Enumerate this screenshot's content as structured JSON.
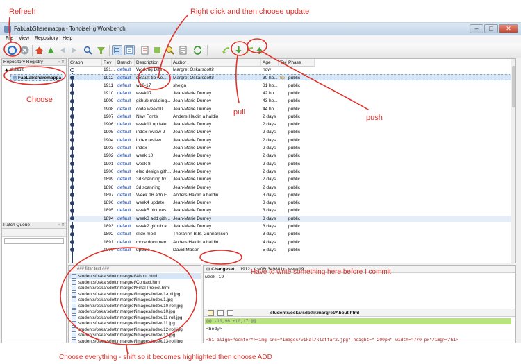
{
  "window": {
    "title": "FabLabSharemappa - TortoiseHg Workbench"
  },
  "menu": [
    "File",
    "View",
    "Repository",
    "Help"
  ],
  "toolbar_icons": [
    "refresh-icon",
    "stop-icon",
    "home-icon",
    "goto-icon",
    "back-icon",
    "forward-icon",
    "search-icon",
    "filter-icon",
    "log-view-icon",
    "manifest-view-icon",
    "annotate-icon",
    "grep-icon",
    "zoom-icon",
    "status-icon",
    "sync-icon",
    "incoming-icon",
    "pull-icon",
    "outgoing-icon",
    "push-icon"
  ],
  "left_panel": {
    "registry_title": "Repository Registry",
    "group": "default",
    "repo": "FabLabSharemappa",
    "patch_queue_title": "Patch Queue"
  },
  "columns": [
    "Graph",
    "Rev",
    "Branch",
    "Description",
    "Author",
    "Age",
    "Tags",
    "Phase"
  ],
  "rows": [
    {
      "rev": "191...",
      "branch": "default",
      "desc": "Working Dire...",
      "author": "Margret Oskarsdottir",
      "age": "now",
      "tags": "",
      "phase": "",
      "kind": "wd"
    },
    {
      "rev": "1912",
      "branch": "default",
      "desc": "default tip  we...",
      "author": "Margret Oskarsdottir",
      "age": "30 ho...",
      "tags": "tip",
      "phase": "public",
      "kind": "sel"
    },
    {
      "rev": "1911",
      "branch": "default",
      "desc": "w10-17",
      "author": "shelga",
      "age": "31 ho...",
      "tags": "",
      "phase": "public",
      "kind": ""
    },
    {
      "rev": "1910",
      "branch": "default",
      "desc": "week17",
      "author": "Jean-Marie Durney",
      "age": "42 ho...",
      "tags": "",
      "phase": "public",
      "kind": ""
    },
    {
      "rev": "1909",
      "branch": "default",
      "desc": "github mol.ding...",
      "author": "Jean-Marie Durney",
      "age": "43 ho...",
      "tags": "",
      "phase": "public",
      "kind": ""
    },
    {
      "rev": "1908",
      "branch": "default",
      "desc": "code week10",
      "author": "Jean-Marie Durney",
      "age": "44 ho...",
      "tags": "",
      "phase": "public",
      "kind": ""
    },
    {
      "rev": "1907",
      "branch": "default",
      "desc": "New Fonts",
      "author": "Anders Haldin  a haldin",
      "age": "2 days",
      "tags": "",
      "phase": "public",
      "kind": ""
    },
    {
      "rev": "1906",
      "branch": "default",
      "desc": "week11 update",
      "author": "Jean-Marie Durney",
      "age": "2 days",
      "tags": "",
      "phase": "public",
      "kind": ""
    },
    {
      "rev": "1905",
      "branch": "default",
      "desc": "index review 2",
      "author": "Jean-Marie Durney",
      "age": "2 days",
      "tags": "",
      "phase": "public",
      "kind": ""
    },
    {
      "rev": "1904",
      "branch": "default",
      "desc": "index review",
      "author": "Jean-Marie Durney",
      "age": "2 days",
      "tags": "",
      "phase": "public",
      "kind": ""
    },
    {
      "rev": "1903",
      "branch": "default",
      "desc": "index",
      "author": "Jean-Marie Durney",
      "age": "2 days",
      "tags": "",
      "phase": "public",
      "kind": ""
    },
    {
      "rev": "1902",
      "branch": "default",
      "desc": "week 10",
      "author": "Jean-Marie Durney",
      "age": "2 days",
      "tags": "",
      "phase": "public",
      "kind": ""
    },
    {
      "rev": "1901",
      "branch": "default",
      "desc": "week 8",
      "author": "Jean-Marie Durney",
      "age": "2 days",
      "tags": "",
      "phase": "public",
      "kind": ""
    },
    {
      "rev": "1900",
      "branch": "default",
      "desc": "elec design gith...",
      "author": "Jean-Marie Durney",
      "age": "2 days",
      "tags": "",
      "phase": "public",
      "kind": ""
    },
    {
      "rev": "1899",
      "branch": "default",
      "desc": "3d scanning fix ...",
      "author": "Jean-Marie Durney",
      "age": "2 days",
      "tags": "",
      "phase": "public",
      "kind": ""
    },
    {
      "rev": "1898",
      "branch": "default",
      "desc": "3d scanning",
      "author": "Jean-Marie Durney",
      "age": "2 days",
      "tags": "",
      "phase": "public",
      "kind": ""
    },
    {
      "rev": "1897",
      "branch": "default",
      "desc": "Week 16 adn Fi...",
      "author": "Anders Haldin  a haldin",
      "age": "3 days",
      "tags": "",
      "phase": "public",
      "kind": ""
    },
    {
      "rev": "1896",
      "branch": "default",
      "desc": "week4 update",
      "author": "Jean-Marie Durney",
      "age": "3 days",
      "tags": "",
      "phase": "public",
      "kind": ""
    },
    {
      "rev": "1895",
      "branch": "default",
      "desc": "week5 pictures ...",
      "author": "Jean-Marie Durney",
      "age": "3 days",
      "tags": "",
      "phase": "public",
      "kind": ""
    },
    {
      "rev": "1894",
      "branch": "default",
      "desc": "week3 add gith...",
      "author": "Jean-Marie Durney",
      "age": "3 days",
      "tags": "",
      "phase": "public",
      "kind": "hl"
    },
    {
      "rev": "1893",
      "branch": "default",
      "desc": "week2 github a...",
      "author": "Jean-Marie Durney",
      "age": "3 days",
      "tags": "",
      "phase": "public",
      "kind": ""
    },
    {
      "rev": "1892",
      "branch": "default",
      "desc": "slide mod",
      "author": "Thorarinn B.B. Gunnarsson",
      "age": "3 days",
      "tags": "",
      "phase": "public",
      "kind": ""
    },
    {
      "rev": "1891",
      "branch": "default",
      "desc": "more documen...",
      "author": "Anders Haldin  a haldin",
      "age": "4 days",
      "tags": "",
      "phase": "public",
      "kind": ""
    },
    {
      "rev": "1890",
      "branch": "default",
      "desc": "update",
      "author": "David Mason",
      "age": "5 days",
      "tags": "",
      "phase": "public",
      "kind": ""
    }
  ],
  "files": {
    "filter_placeholder": "### filter text ###",
    "items": [
      "students/oskarsdottir.margret/About.html",
      "students/oskarsdottir.margret/Contact.html",
      "students/oskarsdottir.margret/Final Project.html",
      "students/oskarsdottir.margret/images/Index/1-roll.jpg",
      "students/oskarsdottir.margret/images/Index/1.jpg",
      "students/oskarsdottir.margret/images/Index/10-roll.jpg",
      "students/oskarsdottir.margret/images/Index/10.jpg",
      "students/oskarsdottir.margret/images/Index/11-roll.jpg",
      "students/oskarsdottir.margret/images/Index/11.jpg",
      "students/oskarsdottir.margret/images/Index/12-roll.jpg",
      "students/oskarsdottir.margret/images/Index/12.jpg",
      "students/oskarsdottir.margret/images/Index/13-roll.jpg"
    ]
  },
  "changeset": {
    "label": "Changeset:",
    "rev": "1912",
    "hash": "(ce08c349881)",
    "name": "week19",
    "message": "week 19",
    "diff_file": "students/oskarsdottir.margret/About.html",
    "hunk": "@@ -10,96 +10,17 @@",
    "lines": [
      "<body>",
      "<h1 align=\"center\"><img src=\"images/vikal/klettar2.jpg\" height=\" 200px\" width=\"770 px\"/img></h1>"
    ]
  },
  "annotations": {
    "refresh": "Refresh",
    "right_click": "Right click and then choose update",
    "choose": "Choose",
    "pull": "pull",
    "push": "push",
    "write": "Have to write something here before I commit",
    "choose_everything": "Choose everything - shift so it becomes highlighted then choose ADD"
  },
  "colors": {
    "annotation": "#e0312a",
    "selection": "#d7e6f6",
    "diff_hunk": "#b9e37d"
  }
}
